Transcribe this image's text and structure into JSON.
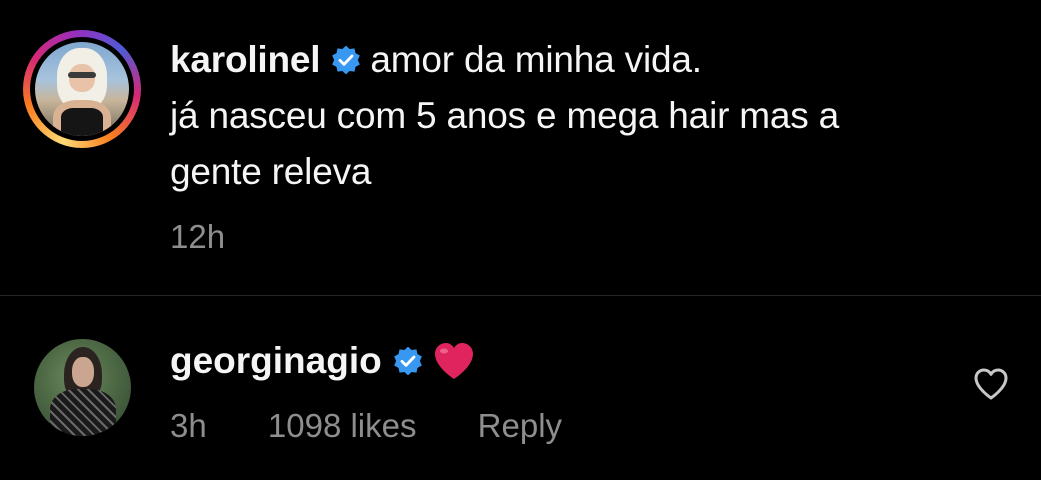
{
  "comments": [
    {
      "username": "karolinel",
      "verified": true,
      "text_first": "amor da minha vida.",
      "text_rest": "já nasceu com 5 anos e mega hair mas a gente releva",
      "time": "12h",
      "avatar_icon": "profile-photo-story-ring"
    },
    {
      "username": "georginagio",
      "verified": true,
      "text": "❤️",
      "time": "3h",
      "likes": "1098 likes",
      "reply": "Reply",
      "avatar_icon": "profile-photo"
    }
  ],
  "colors": {
    "background": "#000000",
    "text": "#f5f5f5",
    "meta": "#8e8e8e",
    "verified": "#3897f0",
    "heart": "#e0245e",
    "divider": "#262626"
  },
  "icons": {
    "verified": "verified-badge-icon",
    "like": "heart-outline-icon"
  }
}
